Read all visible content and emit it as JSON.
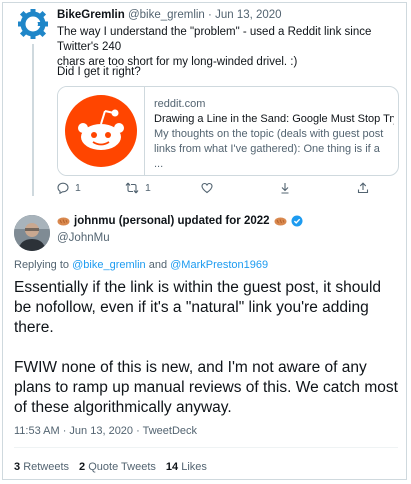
{
  "tweet1": {
    "author_name": "BikeGremlin",
    "handle": "@bike_gremlin",
    "separator": "·",
    "date": "Jun 13, 2020",
    "text_lines": [
      "The way I understand the \"problem\" - used a Reddit link since Twitter's 240",
      "chars are too short for my long-winded drivel. :)"
    ],
    "question": "Did I get it right?",
    "link_card": {
      "domain": "reddit.com",
      "title": "Drawing a Line in the Sand: Google Must Stop Tryi...",
      "description": "My thoughts on the topic (deals with guest post links from what I've gathered): One thing is if a ..."
    },
    "actions": {
      "reply_count": "1",
      "retweet_count": "1"
    }
  },
  "tweet2": {
    "author_name": "johnmu (personal) updated for 2022",
    "handle": "@JohnMu",
    "replying_prefix": "Replying to",
    "reply_user_1": "@bike_gremlin",
    "reply_and": "and",
    "reply_user_2": "@MarkPreston1969",
    "paragraph1": "Essentially if the link is within the guest post, it should be nofollow, even if it's a \"natural\" link you're adding there.",
    "paragraph2": "FWIW none of this is new, and I'm not aware of any plans to ramp up manual reviews of this. We catch most of these algorithmically anyway.",
    "meta": "11:53 AM · Jun 13, 2020 · TweetDeck",
    "stats": {
      "retweets_count": "3",
      "retweets_label": "Retweets",
      "quotes_count": "2",
      "quotes_label": "Quote Tweets",
      "likes_count": "14",
      "likes_label": "Likes"
    }
  },
  "colors": {
    "link_blue": "#1d9bf0",
    "reddit_orange": "#ff4500",
    "verified_blue": "#1d9bf0",
    "text_muted": "#536471"
  },
  "icons": {
    "tweet1_avatar": "gear-logo-icon",
    "reply": "reply-icon",
    "retweet": "retweet-icon",
    "like": "heart-icon",
    "download": "download-icon",
    "share": "share-icon",
    "reddit": "reddit-logo-icon",
    "verified": "verified-badge-icon"
  }
}
